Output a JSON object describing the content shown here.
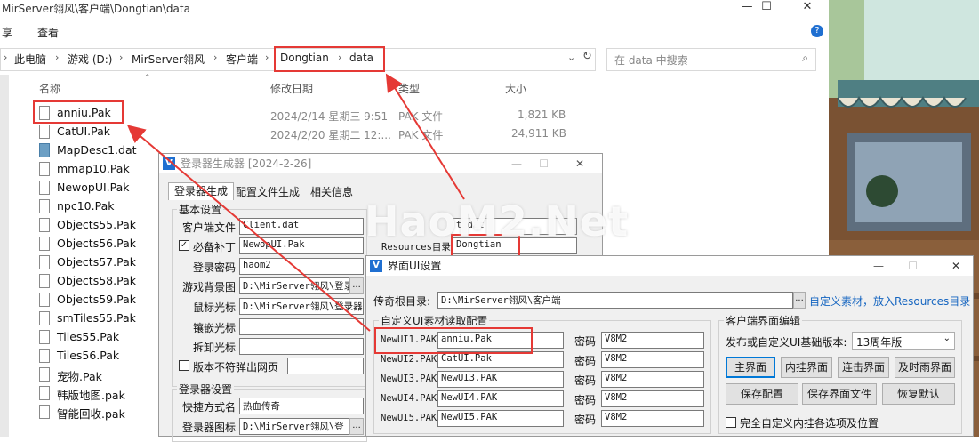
{
  "explorer": {
    "title": "MirServer翎风\\客户端\\Dongtian\\data",
    "ribbon": [
      "享",
      "查看"
    ],
    "breadcrumb": [
      "此电脑",
      "游戏 (D:)",
      "MirServer翎风",
      "客户端",
      "Dongtian",
      "data"
    ],
    "search_placeholder": "在 data 中搜索",
    "columns": [
      "名称",
      "修改日期",
      "类型",
      "大小"
    ],
    "files": [
      {
        "name": "anniu.Pak",
        "type": "pak"
      },
      {
        "name": "CatUI.Pak",
        "type": "pak"
      },
      {
        "name": "MapDesc1.dat",
        "type": "dat"
      },
      {
        "name": "mmap10.Pak",
        "type": "pak"
      },
      {
        "name": "NewopUI.Pak",
        "type": "pak"
      },
      {
        "name": "npc10.Pak",
        "type": "pak"
      },
      {
        "name": "Objects55.Pak",
        "type": "pak"
      },
      {
        "name": "Objects56.Pak",
        "type": "pak"
      },
      {
        "name": "Objects57.Pak",
        "type": "pak"
      },
      {
        "name": "Objects58.Pak",
        "type": "pak"
      },
      {
        "name": "Objects59.Pak",
        "type": "pak"
      },
      {
        "name": "smTiles55.Pak",
        "type": "pak"
      },
      {
        "name": "Tiles55.Pak",
        "type": "pak"
      },
      {
        "name": "Tiles56.Pak",
        "type": "pak"
      },
      {
        "name": "宠物.Pak",
        "type": "pak"
      },
      {
        "name": "韩版地图.pak",
        "type": "pak"
      },
      {
        "name": "智能回收.pak",
        "type": "pak"
      }
    ],
    "rows_meta": [
      {
        "date": "2024/2/14 星期三 9:51",
        "type": "PAK 文件",
        "size": "1,821 KB"
      },
      {
        "date": "2024/2/20 星期二 12:...",
        "type": "PAK 文件",
        "size": "24,911 KB"
      }
    ]
  },
  "launcher": {
    "title": "登录器生成器 [2024-2-26]",
    "tabs": [
      "登录器生成",
      "配置文件生成",
      "相关信息"
    ],
    "basic_group": "基本设置",
    "client_file_label": "客户端文件",
    "client_file_value": "Client.dat",
    "patch_label": "必备补丁",
    "patch_value": "NewopUI.Pak",
    "pwd_label": "登录密码",
    "pwd_value": "haom2",
    "bg_label": "游戏背景图",
    "bg_value": "D:\\MirServer翎风\\登录",
    "cursor_label": "鼠标光标",
    "cursor_value": "D:\\MirServer翎风\\登录器",
    "inlay_label": "镶嵌光标",
    "split_label": "拆卸光标",
    "version_label": "版本不符弹出网页",
    "login_group": "登录器设置",
    "shortcut_label": "快捷方式名",
    "shortcut_value": "热血传奇",
    "icon_label": "登录器图标",
    "icon_value": "D:\\MirServer翎风\\登",
    "right_value": "t.dat",
    "resources_label": "Resources目录",
    "resources_value": "Dongtian"
  },
  "watermark": "HaoM2.Net",
  "ui_dialog": {
    "title": "界面UI设置",
    "root_label": "传奇根目录:",
    "root_value": "D:\\MirServer翎风\\客户端",
    "browse": "...",
    "custom_link": "自定义素材，放入Resources目录",
    "custom_group": "自定义UI素材读取配置",
    "pwd_label": "密码",
    "rows": [
      {
        "key": "NewUI1.PAK",
        "file": "anniu.Pak",
        "pwd": "V8M2"
      },
      {
        "key": "NewUI2.PAK",
        "file": "CatUI.Pak",
        "pwd": "V8M2"
      },
      {
        "key": "NewUI3.PAK",
        "file": "NewUI3.PAK",
        "pwd": "V8M2"
      },
      {
        "key": "NewUI4.PAK",
        "file": "NewUI4.PAK",
        "pwd": "V8M2"
      },
      {
        "key": "NewUI5.PAK",
        "file": "NewUI5.PAK",
        "pwd": "V8M2"
      }
    ],
    "editor_group": "客户端界面编辑",
    "version_label": "发布或自定义UI基础版本:",
    "version_value": "13周年版",
    "buttons": [
      "主界面",
      "内挂界面",
      "连击界面",
      "及时雨界面",
      "保存配置",
      "保存界面文件",
      "恢复默认"
    ],
    "full_custom_label": "完全自定义内挂各选项及位置"
  },
  "colors": {
    "annotation_red": "#e53935",
    "link_blue": "#1565c0",
    "accent": "#0078d7"
  }
}
